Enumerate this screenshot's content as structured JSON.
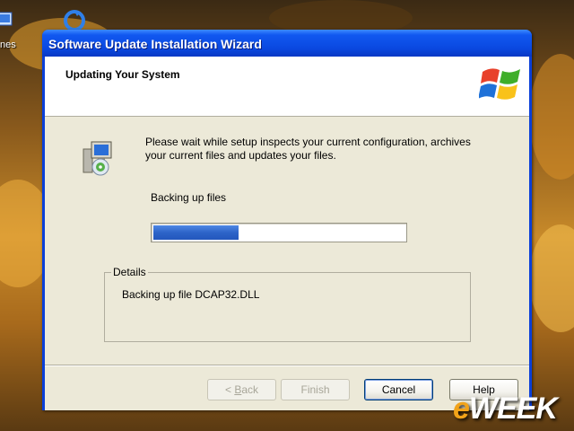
{
  "desktop": {
    "icon_label_partial": "nes"
  },
  "window": {
    "title": "Software Update Installation Wizard"
  },
  "wizard": {
    "header_title": "Updating Your System",
    "intro_text": "Please wait while setup inspects your current configuration, archives your current files and updates your files.",
    "status_text": "Backing up files",
    "progress_fraction": 0.34,
    "details_legend": "Details",
    "details_text": "Backing up file DCAP32.DLL"
  },
  "buttons": {
    "back_prefix": "< ",
    "back_mnemonic": "B",
    "back_rest": "ack",
    "finish": "Finish",
    "cancel": "Cancel",
    "help": "Help"
  },
  "watermark": {
    "e": "e",
    "rest": "WEEK"
  },
  "colors": {
    "titlebar": "#0a48e0",
    "progress": "#2d64c8",
    "dialog_bg": "#ece9d8"
  },
  "icons": {
    "window_logo": "windows-xp-logo-icon",
    "setup": "setup-computer-disc-icon",
    "desktop": "desktop-shortcut-icon"
  }
}
